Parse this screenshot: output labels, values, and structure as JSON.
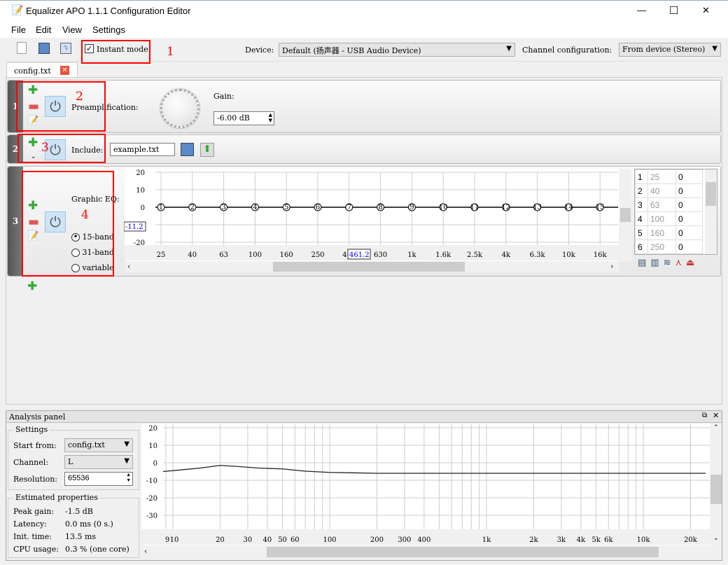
{
  "window": {
    "title": "Equalizer APO 1.1.1 Configuration Editor",
    "minimize": "—",
    "maximize": "☐",
    "close": "✕"
  },
  "menu": [
    "File",
    "Edit",
    "View",
    "Settings"
  ],
  "toolbar": {
    "instant_mode": "Instant mode",
    "instant_checked": true,
    "device_label": "Device:",
    "device_value": "Default (扬声器 - USB Audio Device)",
    "channel_label": "Channel configuration:",
    "channel_value": "From device (Stereo)"
  },
  "tabs": [
    {
      "label": "config.txt"
    }
  ],
  "filters": [
    {
      "index": "1",
      "label": "Preamplification:",
      "gain_label": "Gain:",
      "gain_value": "-6.00 dB"
    },
    {
      "index": "2",
      "label": "Include:",
      "file": "example.txt"
    },
    {
      "index": "3",
      "label": "Graphic EQ:",
      "options": [
        "15-band",
        "31-band",
        "variable"
      ],
      "selected": "15-band",
      "chart": {
        "type": "line",
        "y_ticks": [
          "20",
          "10",
          "0",
          "-10",
          "-20"
        ],
        "ylim": [
          -25,
          20
        ],
        "bands": [
          "25",
          "40",
          "63",
          "100",
          "160",
          "250",
          "400",
          "630",
          "1k",
          "1.6k",
          "2.5k",
          "4k",
          "6.3k",
          "10k",
          "16k"
        ],
        "band_numbers": [
          "1",
          "2",
          "3",
          "4",
          "5",
          "6",
          "7",
          "8",
          "9",
          "10",
          "11",
          "12",
          "13",
          "14",
          "15"
        ],
        "gains": [
          0,
          0,
          0,
          0,
          0,
          0,
          0,
          0,
          0,
          0,
          0,
          0,
          0,
          0,
          0
        ],
        "cursor_y": "-11.2",
        "cursor_x": "461.2"
      },
      "table": [
        [
          "1",
          "25",
          "0"
        ],
        [
          "2",
          "40",
          "0"
        ],
        [
          "3",
          "63",
          "0"
        ],
        [
          "4",
          "100",
          "0"
        ],
        [
          "5",
          "160",
          "0"
        ],
        [
          "6",
          "250",
          "0"
        ]
      ]
    }
  ],
  "annotations": [
    "1",
    "2",
    "3",
    "4"
  ],
  "analysis": {
    "title": "Analysis panel",
    "settings_title": "Settings",
    "start_from_label": "Start from:",
    "start_from": "config.txt",
    "channel_label": "Channel:",
    "channel": "L",
    "resolution_label": "Resolution:",
    "resolution": "65536",
    "estimated_title": "Estimated properties",
    "props": [
      [
        "Peak gain:",
        "-1.5 dB"
      ],
      [
        "Latency:",
        "0.0 ms (0 s.)"
      ],
      [
        "Init. time:",
        "13.5 ms"
      ],
      [
        "CPU usage:",
        "0.3 % (one core)"
      ]
    ],
    "chart_data": {
      "type": "line",
      "y_ticks": [
        "20",
        "10",
        "0",
        "-10",
        "-20",
        "-30"
      ],
      "ylim": [
        -35,
        20
      ],
      "x_ticks": [
        "9",
        "10",
        "20",
        "30",
        "40",
        "50",
        "60",
        "100",
        "200",
        "300",
        "400",
        "1k",
        "2k",
        "3k",
        "4k",
        "5k",
        "6k",
        "10k",
        "20k"
      ],
      "x_values": [
        9,
        10,
        20,
        30,
        40,
        50,
        60,
        100,
        200,
        300,
        400,
        1000,
        2000,
        3000,
        4000,
        5000,
        6000,
        10000,
        20000
      ],
      "curve": [
        [
          9,
          -5
        ],
        [
          15,
          -3
        ],
        [
          20,
          -1.5
        ],
        [
          25,
          -2
        ],
        [
          35,
          -3
        ],
        [
          50,
          -3.5
        ],
        [
          70,
          -4.8
        ],
        [
          100,
          -5.5
        ],
        [
          200,
          -6
        ],
        [
          1000,
          -6
        ],
        [
          10000,
          -6
        ],
        [
          25000,
          -6
        ]
      ]
    }
  }
}
